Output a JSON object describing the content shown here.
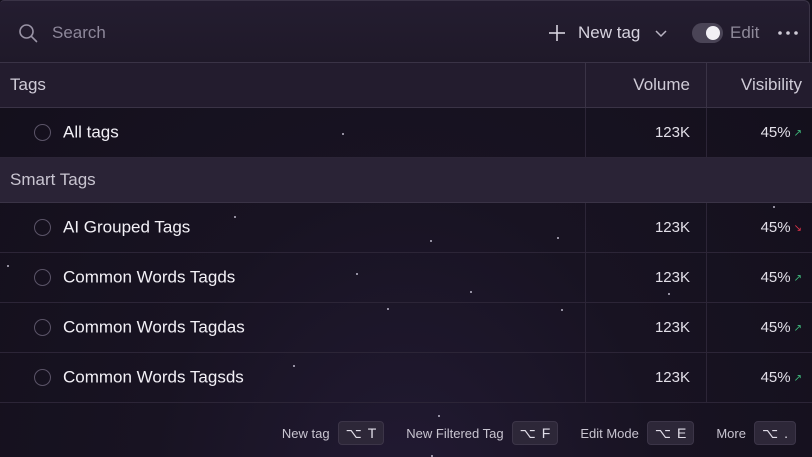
{
  "search": {
    "placeholder": "Search"
  },
  "toolbar": {
    "new_tag_label": "New tag",
    "edit_label": "Edit",
    "edit_toggle_on": true
  },
  "table": {
    "headers": {
      "name": "Tags",
      "volume": "Volume",
      "visibility": "Visibility"
    },
    "all_tags": {
      "name": "All tags",
      "volume": "123K",
      "visibility": "45%",
      "trend": "up"
    },
    "section_label": "Smart Tags",
    "rows": [
      {
        "name": "AI Grouped Tags",
        "volume": "123K",
        "visibility": "45%",
        "trend": "down"
      },
      {
        "name": "Common Words Tagds",
        "volume": "123K",
        "visibility": "45%",
        "trend": "up"
      },
      {
        "name": "Common Words Tagdas",
        "volume": "123K",
        "visibility": "45%",
        "trend": "up"
      },
      {
        "name": "Common Words Tagsds",
        "volume": "123K",
        "visibility": "45%",
        "trend": "up"
      }
    ]
  },
  "shortcuts": [
    {
      "label": "New tag",
      "modifier": "⌥",
      "key": "T"
    },
    {
      "label": "New Filtered Tag",
      "modifier": "⌥",
      "key": "F"
    },
    {
      "label": "Edit Mode",
      "modifier": "⌥",
      "key": "E"
    },
    {
      "label": "More",
      "modifier": "⌥",
      "key": "."
    }
  ],
  "colors": {
    "trend_up": "#3fbf7f",
    "trend_down": "#e2334a",
    "background": "#181322"
  }
}
